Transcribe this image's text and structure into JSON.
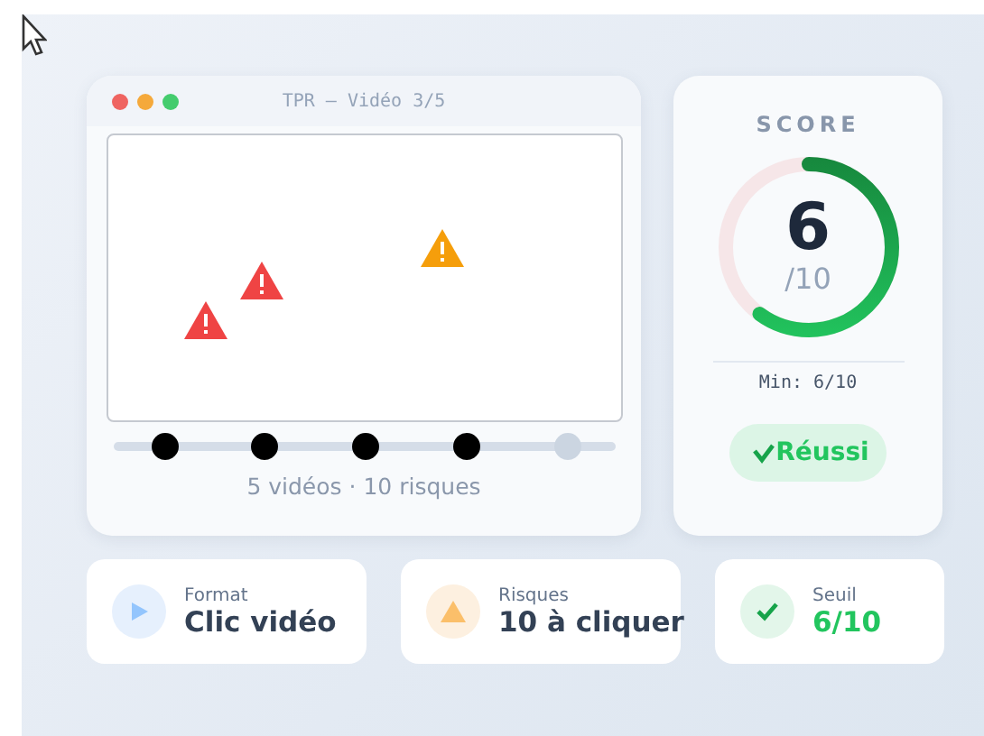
{
  "video_window": {
    "title": "TPR — Vidéo 3/5",
    "hazards": [
      {
        "color": "#ef4444"
      },
      {
        "color": "#ef4444"
      },
      {
        "color": "#f59e0b"
      }
    ],
    "steps": [
      {
        "done": true
      },
      {
        "done": true
      },
      {
        "done": true
      },
      {
        "done": true
      },
      {
        "done": false
      }
    ],
    "caption": "5 vidéos · 10 risques"
  },
  "score": {
    "heading": "SCORE",
    "value": "6",
    "total": "/10",
    "level": 0.6,
    "minimum": "Min: 6/10",
    "status": "Réussi",
    "passed": true
  },
  "info_cards": [
    {
      "kind": "format",
      "label": "Format",
      "value": "Clic vidéo"
    },
    {
      "kind": "risks",
      "label": "Risques",
      "value": "10 à cliquer"
    },
    {
      "kind": "threshold",
      "label": "Seuil",
      "value": "6/10"
    }
  ]
}
